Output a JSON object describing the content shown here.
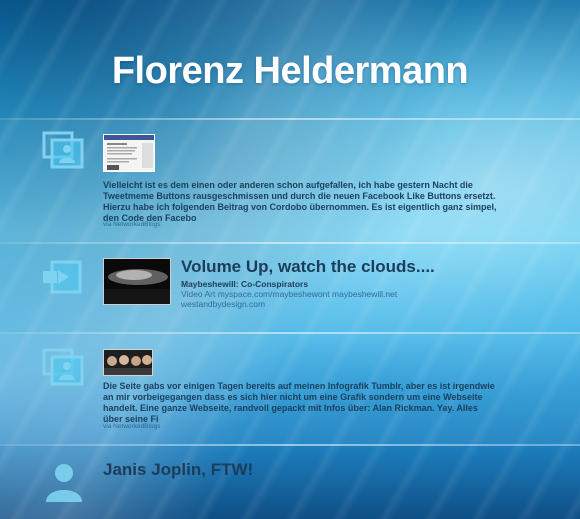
{
  "header": {
    "title": "Florenz Heldermann"
  },
  "posts": [
    {
      "type": "photo-link",
      "text": "Vielleicht ist es dem einen oder anderen schon aufgefallen, ich habe gestern Nacht die Tweetmeme Buttons rausgeschmissen und durch die neuen Facebook Like Buttons ersetzt. Hierzu habe ich folgenden Beitrag von Cordobo übernommen. Es ist eigentlich ganz simpel, den Code den Facebo",
      "via": "via NetworkedBlogs"
    },
    {
      "type": "video",
      "title": "Volume Up, watch the clouds....",
      "subtitle": "Maybeshewill: Co-Conspirators",
      "description": "Video Art myspace.com/maybeshewont maybeshewill.net westandbydesign.com"
    },
    {
      "type": "photo-link",
      "text": "Die Seite gabs vor einigen Tagen bereits auf meinen Infografik Tumblr, aber es ist irgendwie an mir vorbeigegangen dass es sich hier nicht um eine Grafik sondern um eine Webseite handelt. Eine ganze Webseite, randvoll gepackt mit Infos über: Alan Rickman. Yay. Alles über seine Fi",
      "via": "via NetworkedBlogs"
    },
    {
      "type": "status",
      "title": "Janis Joplin, FTW!"
    }
  ],
  "colors": {
    "text_dark": "#1b3d5b",
    "link_blue": "#2f6f98",
    "bg_light": "#4cc6ef",
    "bg_dark": "#0f4f86"
  }
}
